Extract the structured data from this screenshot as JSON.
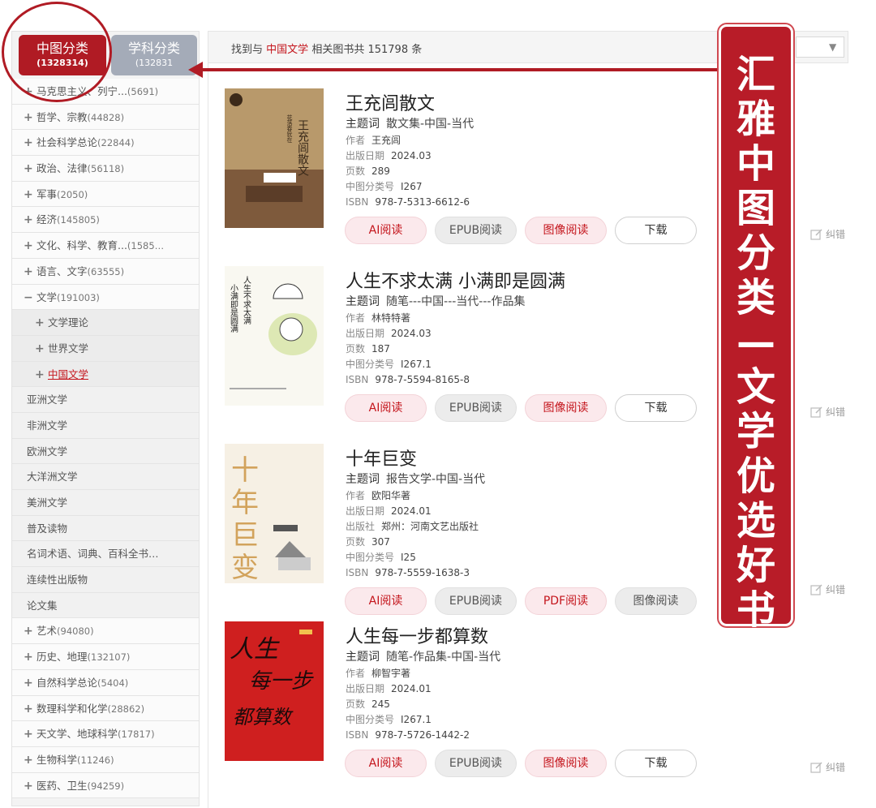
{
  "tabs": [
    {
      "label": "中图分类",
      "count": "(1328314)"
    },
    {
      "label": "学科分类",
      "count": "(132831"
    }
  ],
  "categories": [
    {
      "sign": "+",
      "label": "马克思主义、列宁...",
      "count": "(5691)",
      "kind": "top"
    },
    {
      "sign": "+",
      "label": "哲学、宗教",
      "count": "(44828)",
      "kind": "top"
    },
    {
      "sign": "+",
      "label": "社会科学总论",
      "count": "(22844)",
      "kind": "top"
    },
    {
      "sign": "+",
      "label": "政治、法律",
      "count": "(56118)",
      "kind": "top"
    },
    {
      "sign": "+",
      "label": "军事",
      "count": "(2050)",
      "kind": "top"
    },
    {
      "sign": "+",
      "label": "经济",
      "count": "(145805)",
      "kind": "top"
    },
    {
      "sign": "+",
      "label": "文化、科学、教育...",
      "count": "(1585…",
      "kind": "top"
    },
    {
      "sign": "+",
      "label": "语言、文字",
      "count": "(63555)",
      "kind": "top"
    },
    {
      "sign": "−",
      "label": "文学",
      "count": "(191003)",
      "kind": "top"
    },
    {
      "sign": "+",
      "label": "文学理论",
      "count": "",
      "kind": "sub"
    },
    {
      "sign": "+",
      "label": "世界文学",
      "count": "",
      "kind": "sub"
    },
    {
      "sign": "+",
      "label": "中国文学",
      "count": "",
      "kind": "sub",
      "active": true
    },
    {
      "sign": "",
      "label": "亚洲文学",
      "count": "",
      "kind": "plain"
    },
    {
      "sign": "",
      "label": "非洲文学",
      "count": "",
      "kind": "plain"
    },
    {
      "sign": "",
      "label": "欧洲文学",
      "count": "",
      "kind": "plain"
    },
    {
      "sign": "",
      "label": "大洋洲文学",
      "count": "",
      "kind": "plain"
    },
    {
      "sign": "",
      "label": "美洲文学",
      "count": "",
      "kind": "plain"
    },
    {
      "sign": "",
      "label": "普及读物",
      "count": "",
      "kind": "plain"
    },
    {
      "sign": "",
      "label": "名词术语、词典、百科全书…",
      "count": "",
      "kind": "plain"
    },
    {
      "sign": "",
      "label": "连续性出版物",
      "count": "",
      "kind": "plain"
    },
    {
      "sign": "",
      "label": "论文集",
      "count": "",
      "kind": "plain"
    },
    {
      "sign": "+",
      "label": "艺术",
      "count": "(94080)",
      "kind": "top"
    },
    {
      "sign": "+",
      "label": "历史、地理",
      "count": "(132107)",
      "kind": "top"
    },
    {
      "sign": "+",
      "label": "自然科学总论",
      "count": "(5404)",
      "kind": "top"
    },
    {
      "sign": "+",
      "label": "数理科学和化学",
      "count": "(28862)",
      "kind": "top"
    },
    {
      "sign": "+",
      "label": "天文学、地球科学",
      "count": "(17817)",
      "kind": "top"
    },
    {
      "sign": "+",
      "label": "生物科学",
      "count": "(11246)",
      "kind": "top"
    },
    {
      "sign": "+",
      "label": "医药、卫生",
      "count": "(94259)",
      "kind": "top"
    }
  ],
  "search_info": {
    "prefix": "找到与",
    "keyword": "中国文学",
    "middle": "相关图书共",
    "total": "151798",
    "suffix": "条"
  },
  "books": [
    {
      "title": "王充闾散文",
      "meta": [
        {
          "label": "主题词",
          "value": "散文集-中国-当代",
          "subj": true
        },
        {
          "label": "作者",
          "value": "王充闾"
        },
        {
          "label": "出版日期",
          "value": "2024.03"
        },
        {
          "label": "页数",
          "value": "289"
        },
        {
          "label": "中图分类号",
          "value": "I267"
        },
        {
          "label": "ISBN",
          "value": "978-7-5313-6612-6"
        }
      ],
      "buttons": [
        {
          "label": "AI阅读",
          "style": "red"
        },
        {
          "label": "EPUB阅读",
          "style": "grey"
        },
        {
          "label": "图像阅读",
          "style": "red"
        },
        {
          "label": "下载",
          "style": "white"
        }
      ],
      "cover": {
        "text": "王充闾散文",
        "sub": "花落春犹在",
        "bg": "#b89a6a"
      }
    },
    {
      "title": "人生不求太满 小满即是圆满",
      "meta": [
        {
          "label": "主题词",
          "value": "随笔---中国---当代---作品集",
          "subj": true
        },
        {
          "label": "作者",
          "value": "林特特著"
        },
        {
          "label": "出版日期",
          "value": "2024.03"
        },
        {
          "label": "页数",
          "value": "187"
        },
        {
          "label": "中图分类号",
          "value": "I267.1"
        },
        {
          "label": "ISBN",
          "value": "978-7-5594-8165-8"
        }
      ],
      "buttons": [
        {
          "label": "AI阅读",
          "style": "red"
        },
        {
          "label": "EPUB阅读",
          "style": "grey"
        },
        {
          "label": "图像阅读",
          "style": "red"
        },
        {
          "label": "下载",
          "style": "white"
        }
      ],
      "cover": {
        "text": "人生不求太满",
        "sub": "小满即是圆满",
        "bg": "#f7f6ef"
      }
    },
    {
      "title": "十年巨变",
      "meta": [
        {
          "label": "主题词",
          "value": "报告文学-中国-当代",
          "subj": true
        },
        {
          "label": "作者",
          "value": "欧阳华著"
        },
        {
          "label": "出版日期",
          "value": "2024.01"
        },
        {
          "label": "出版社",
          "value": "郑州：河南文艺出版社"
        },
        {
          "label": "页数",
          "value": "307"
        },
        {
          "label": "中图分类号",
          "value": "I25"
        },
        {
          "label": "ISBN",
          "value": "978-7-5559-1638-3"
        }
      ],
      "buttons": [
        {
          "label": "AI阅读",
          "style": "red"
        },
        {
          "label": "EPUB阅读",
          "style": "grey"
        },
        {
          "label": "PDF阅读",
          "style": "red"
        },
        {
          "label": "图像阅读",
          "style": "grey"
        }
      ],
      "cover": {
        "text": "十年巨变",
        "sub": "",
        "bg": "#f6f1e6"
      }
    },
    {
      "title": "人生每一步都算数",
      "meta": [
        {
          "label": "主题词",
          "value": "随笔-作品集-中国-当代",
          "subj": true
        },
        {
          "label": "作者",
          "value": "柳智宇著"
        },
        {
          "label": "出版日期",
          "value": "2024.01"
        },
        {
          "label": "页数",
          "value": "245"
        },
        {
          "label": "中图分类号",
          "value": "I267.1"
        },
        {
          "label": "ISBN",
          "value": "978-7-5726-1442-2"
        }
      ],
      "buttons": [
        {
          "label": "AI阅读",
          "style": "red"
        },
        {
          "label": "EPUB阅读",
          "style": "grey"
        },
        {
          "label": "图像阅读",
          "style": "red"
        },
        {
          "label": "下载",
          "style": "white"
        }
      ],
      "cover": {
        "text": "人生每一步都算数",
        "sub": "",
        "bg": "#cc1d1d"
      }
    }
  ],
  "correction_label": "纠错",
  "banner_text": "汇雅中图分类—文学优选好书",
  "colors": {
    "accent": "#b01b24",
    "keyword": "#c4141b",
    "tab_inactive": "#a4abb8"
  }
}
